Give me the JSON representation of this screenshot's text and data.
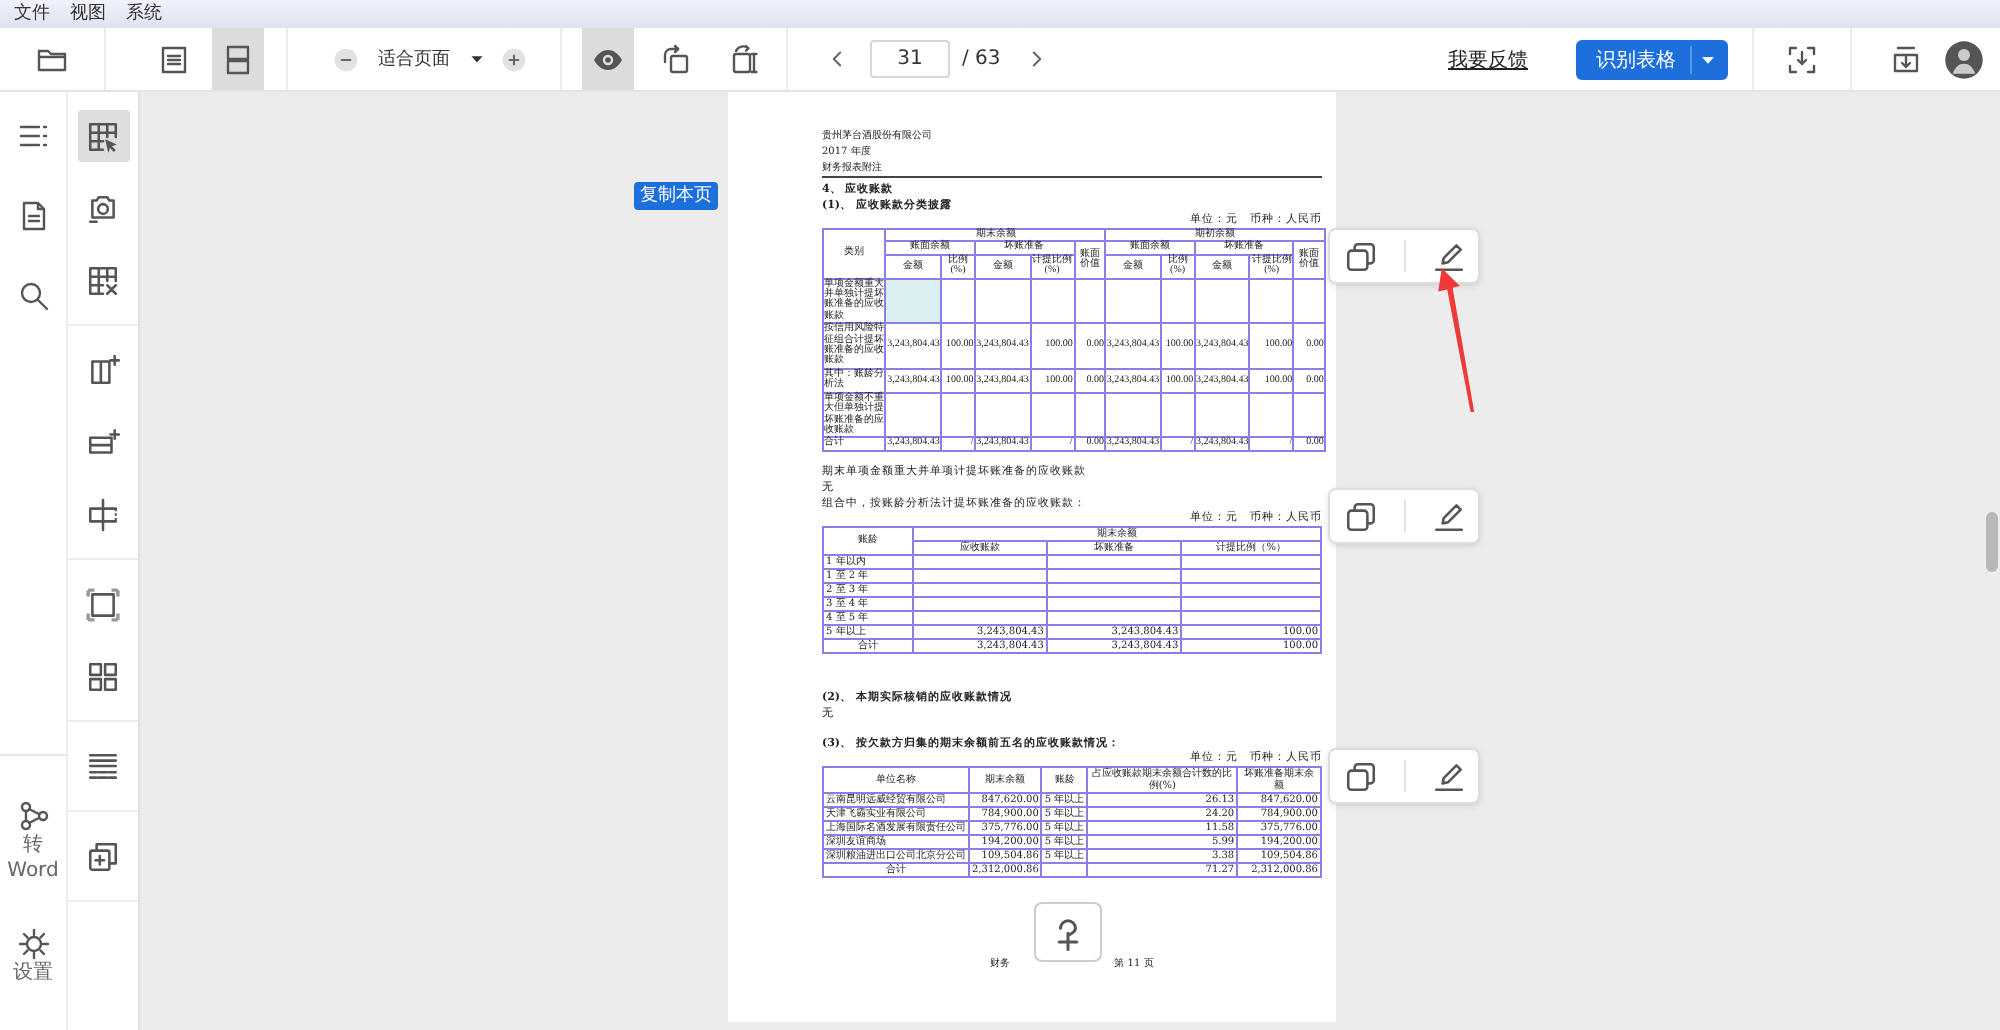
{
  "menu": [
    "文件",
    "视图",
    "系统"
  ],
  "toolbar": {
    "view_modes": [
      {
        "selected": false
      },
      {
        "selected": true
      }
    ],
    "zoom": "适合页面",
    "preview": {
      "selected": true
    },
    "page_current": "31",
    "page_total": "/ 63",
    "feedback_link": "我要反馈",
    "recognize_button": "识别表格"
  },
  "left_rail": {
    "convert_label": "转 Word",
    "settings_label": "设置"
  },
  "tool_groups": [
    [
      {
        "selected": true
      },
      {
        "selected": false
      },
      {
        "selected": false
      }
    ],
    [
      {
        "selected": false
      },
      {
        "selected": false
      },
      {
        "selected": false
      }
    ],
    [
      {
        "selected": false
      },
      {
        "selected": false
      }
    ],
    [
      {
        "selected": false
      }
    ],
    [
      {
        "selected": false
      }
    ]
  ],
  "copy_page_tag": "复制本页",
  "document": {
    "header_lines": [
      "贵州茅台酒股份有限公司",
      "2017 年度",
      "财务报表附注"
    ],
    "blocks": [
      {
        "kind": "heading",
        "text": "4、 应收账款"
      },
      {
        "kind": "heading",
        "text": "(1)、 应收账款分类披露"
      },
      {
        "kind": "unit",
        "text": "单位：元　币种：人民币"
      },
      {
        "kind": "table",
        "header": [
          {
            "text": "类别"
          },
          {
            "text": "期末余额",
            "children": [
              {
                "text": "账面余额",
                "children": [
                  {
                    "text": "金额"
                  },
                  {
                    "text": "比例(%)"
                  }
                ]
              },
              {
                "text": "坏账准备",
                "children": [
                  {
                    "text": "金额"
                  },
                  {
                    "text": "计提比例(%)"
                  }
                ]
              },
              {
                "text": "账面价值"
              }
            ]
          },
          {
            "text": "期初余额",
            "children": [
              {
                "text": "账面余额",
                "children": [
                  {
                    "text": "金额"
                  },
                  {
                    "text": "比例(%)"
                  }
                ]
              },
              {
                "text": "坏账准备",
                "children": [
                  {
                    "text": "金额"
                  },
                  {
                    "text": "计提比例(%)"
                  }
                ]
              },
              {
                "text": "账面价值"
              }
            ]
          }
        ],
        "rows": [
          {
            "kind": "data",
            "cells": [
              "单项金额重大并单独计提坏账准备的应收账款",
              {
                "selected": true
              },
              null,
              null,
              null,
              null,
              null,
              null,
              null,
              null,
              null
            ]
          },
          {
            "kind": "data",
            "cells": [
              "按信用风险特征组合计提坏账准备的应收账款",
              "3,243,804.43",
              "100.00",
              "3,243,804.43",
              "100.00",
              "0.00",
              "3,243,804.43",
              "100.00",
              "3,243,804.43",
              "100.00",
              "0.00"
            ]
          },
          {
            "kind": "data",
            "cells": [
              "其中：账龄分析法",
              "3,243,804.43",
              "100.00",
              "3,243,804.43",
              "100.00",
              "0.00",
              "3,243,804.43",
              "100.00",
              "3,243,804.43",
              "100.00",
              "0.00"
            ]
          },
          {
            "kind": "data",
            "cells": [
              "单项金额不重大但单独计提坏账准备的应收账款",
              null,
              null,
              null,
              null,
              null,
              null,
              null,
              null,
              null,
              null
            ]
          },
          {
            "kind": "data",
            "cells": [
              "合计",
              "3,243,804.43",
              "/",
              "3,243,804.43",
              "/",
              "0.00",
              "3,243,804.43",
              "/",
              "3,243,804.43",
              "/",
              "0.00"
            ]
          }
        ]
      },
      {
        "kind": "para",
        "text": "期末单项金额重大并单项计提坏账准备的应收账款"
      },
      {
        "kind": "para",
        "text": "无"
      },
      {
        "kind": "para",
        "text": "组合中，按账龄分析法计提坏账准备的应收账款："
      },
      {
        "kind": "unit",
        "text": "单位：元　币种：人民币"
      },
      {
        "kind": "table",
        "header": [
          {
            "text": "账龄"
          },
          {
            "text": "期末余额",
            "children": [
              {
                "text": "应收账款"
              },
              {
                "text": "坏账准备"
              },
              {
                "text": "计提比例（%）"
              }
            ]
          }
        ],
        "rows": [
          {
            "kind": "data",
            "cells": [
              "1 年以内",
              null,
              null,
              null
            ]
          },
          {
            "kind": "data",
            "cells": [
              "1 至 2 年",
              null,
              null,
              null
            ]
          },
          {
            "kind": "data",
            "cells": [
              "2 至 3 年",
              null,
              null,
              null
            ]
          },
          {
            "kind": "data",
            "cells": [
              "3 至 4 年",
              null,
              null,
              null
            ]
          },
          {
            "kind": "data",
            "cells": [
              "4 至 5 年",
              null,
              null,
              null
            ]
          },
          {
            "kind": "data",
            "cells": [
              "5 年以上",
              "3,243,804.43",
              "3,243,804.43",
              "100.00"
            ]
          },
          {
            "kind": "total",
            "cells": [
              "合计",
              "3,243,804.43",
              "3,243,804.43",
              "100.00"
            ]
          }
        ]
      },
      {
        "kind": "heading",
        "text": "(2)、 本期实际核销的应收账款情况"
      },
      {
        "kind": "para",
        "text": "无"
      },
      {
        "kind": "heading",
        "text": "(3)、 按欠款方归集的期末余额前五名的应收账款情况："
      },
      {
        "kind": "unit",
        "text": "单位：元　币种：人民币"
      },
      {
        "kind": "table",
        "header": [
          {
            "text": "单位名称"
          },
          {
            "text": "期末余额"
          },
          {
            "text": "账龄"
          },
          {
            "text": "占应收账款期末余额合计数的比例(%)"
          },
          {
            "text": "坏账准备期末余额"
          }
        ],
        "rows": [
          {
            "kind": "data",
            "cells": [
              "云南昆明远威经贸有限公司",
              "847,620.00",
              "5 年以上",
              "26.13",
              "847,620.00"
            ]
          },
          {
            "kind": "data",
            "cells": [
              "天津飞霸实业有限公司",
              "784,900.00",
              "5 年以上",
              "24.20",
              "784,900.00"
            ]
          },
          {
            "kind": "data",
            "cells": [
              "上海国际名酒发展有限责任公司",
              "375,776.00",
              "5 年以上",
              "11.58",
              "375,776.00"
            ]
          },
          {
            "kind": "data",
            "cells": [
              "深圳友谊商场",
              "194,200.00",
              "5 年以上",
              "5.99",
              "194,200.00"
            ]
          },
          {
            "kind": "data",
            "cells": [
              "深圳粮油进出口公司北京分公司",
              "109,504.86",
              "5 年以上",
              "3.38",
              "109,504.86"
            ]
          },
          {
            "kind": "total",
            "cells": [
              "合计",
              "2,312,000.86",
              null,
              "71.27",
              "2,312,000.86"
            ]
          }
        ]
      }
    ],
    "footer": [
      "财务",
      "第 11 页"
    ]
  }
}
